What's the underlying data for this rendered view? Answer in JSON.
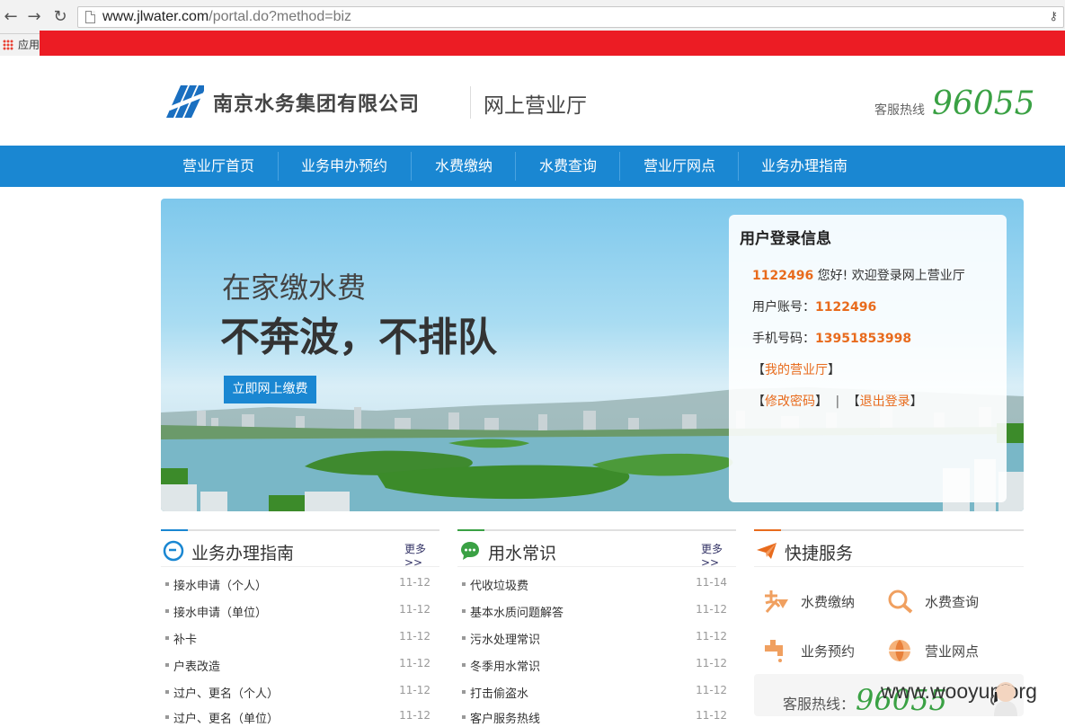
{
  "browser": {
    "url_host": "www.jlwater.com",
    "url_path": "/portal.do?method=biz",
    "bookmark_apps": "应用"
  },
  "header": {
    "company": "南京水务集团有限公司",
    "hall": "网上营业厅",
    "hotline_label": "客服热线",
    "hotline_number": "96055"
  },
  "nav": {
    "items": [
      "营业厅首页",
      "业务申办预约",
      "水费缴纳",
      "水费查询",
      "营业厅网点",
      "业务办理指南"
    ]
  },
  "banner": {
    "subtitle": "在家缴水费",
    "headline": "不奔波，不排队",
    "button": "立即网上缴费"
  },
  "login": {
    "title": "用户登录信息",
    "user_id": "1122496",
    "greeting": "您好! 欢迎登录网上营业厅",
    "account_label": "用户账号：",
    "account": "1122496",
    "phone_label": "手机号码：",
    "phone": "13951853998",
    "bracket_open": "【",
    "bracket_close": "】",
    "my_hall": "我的营业厅",
    "change_pwd": "修改密码",
    "separator": "|",
    "logout": "退出登录"
  },
  "guide": {
    "title": "业务办理指南",
    "more": "更多>>",
    "items": [
      {
        "title": "接水申请（个人）",
        "date": "11-12"
      },
      {
        "title": "接水申请（单位）",
        "date": "11-12"
      },
      {
        "title": "补卡",
        "date": "11-12"
      },
      {
        "title": "户表改造",
        "date": "11-12"
      },
      {
        "title": "过户、更名（个人）",
        "date": "11-12"
      },
      {
        "title": "过户、更名（单位）",
        "date": "11-12"
      }
    ]
  },
  "knowledge": {
    "title": "用水常识",
    "more": "更多>>",
    "items": [
      {
        "title": "代收垃圾费",
        "date": "11-14"
      },
      {
        "title": "基本水质问题解答",
        "date": "11-12"
      },
      {
        "title": "污水处理常识",
        "date": "11-12"
      },
      {
        "title": "冬季用水常识",
        "date": "11-12"
      },
      {
        "title": "打击偷盗水",
        "date": "11-12"
      },
      {
        "title": "客户服务热线",
        "date": "11-12"
      }
    ]
  },
  "quick": {
    "title": "快捷服务",
    "items": [
      {
        "label": "水费缴纳",
        "icon": "payment-icon"
      },
      {
        "label": "水费查询",
        "icon": "search-icon"
      },
      {
        "label": "业务预约",
        "icon": "faucet-icon"
      },
      {
        "label": "营业网点",
        "icon": "outlet-icon"
      }
    ],
    "hotline_label": "客服热线：",
    "hotline_number": "96055"
  },
  "watermark": "www.wooyun.org",
  "colors": {
    "nav_blue": "#1a87d2",
    "accent_orange": "#e86b1d",
    "hotline_green": "#3aa144",
    "top_red": "#ec1c24"
  }
}
